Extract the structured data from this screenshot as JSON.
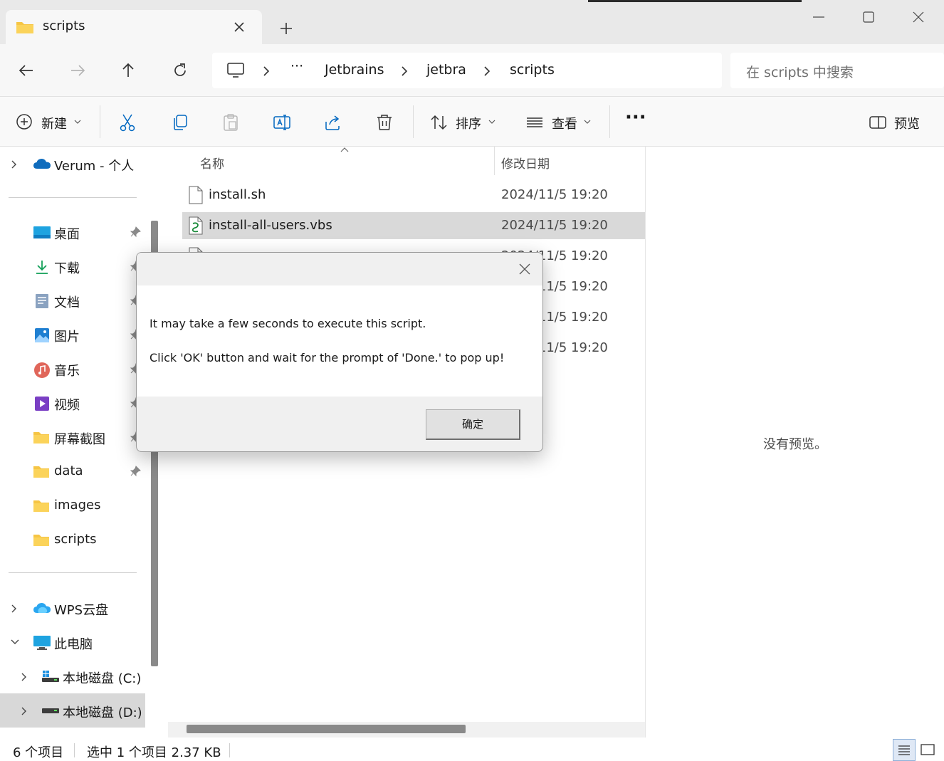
{
  "window": {
    "tab_title": "scripts"
  },
  "address": {
    "overflow": "···",
    "crumbs": [
      "Jetbrains",
      "jetbra",
      "scripts"
    ]
  },
  "search": {
    "placeholder": "在 scripts 中搜索"
  },
  "toolbar": {
    "new_label": "新建",
    "sort_label": "排序",
    "view_label": "查看",
    "more_label": "···",
    "preview_label": "预览"
  },
  "sidebar": {
    "cloud_item": "Verum - 个人",
    "quick_access": [
      {
        "label": "桌面",
        "icon": "desktop-icon"
      },
      {
        "label": "下载",
        "icon": "download-icon"
      },
      {
        "label": "文档",
        "icon": "documents-icon"
      },
      {
        "label": "图片",
        "icon": "pictures-icon"
      },
      {
        "label": "音乐",
        "icon": "music-icon"
      },
      {
        "label": "视频",
        "icon": "videos-icon"
      },
      {
        "label": "屏幕截图",
        "icon": "folder-icon"
      },
      {
        "label": "data",
        "icon": "folder-icon"
      },
      {
        "label": "images",
        "icon": "folder-icon"
      },
      {
        "label": "scripts",
        "icon": "folder-icon"
      }
    ],
    "wps": "WPS云盘",
    "this_pc": "此电脑",
    "drive_c": "本地磁盘 (C:)",
    "drive_d": "本地磁盘 (D:)"
  },
  "filelist": {
    "col_name": "名称",
    "col_date": "修改日期",
    "rows": [
      {
        "name": "install.sh",
        "date": "2024/11/5 19:20"
      },
      {
        "name": "install-all-users.vbs",
        "date": "2024/11/5 19:20"
      },
      {
        "name": "",
        "date": "2024/11/5 19:20"
      },
      {
        "name": "",
        "date": "2024/11/5 19:20"
      },
      {
        "name": "",
        "date": "2024/11/5 19:20"
      },
      {
        "name": "",
        "date": "2024/11/5 19:20"
      }
    ]
  },
  "preview": {
    "empty_text": "没有预览。"
  },
  "status": {
    "count": "6 个项目",
    "selection": "选中 1 个项目  2.37 KB"
  },
  "dialog": {
    "line1": "It may take a few seconds to execute this script.",
    "line2": "Click 'OK' button and wait for the prompt of 'Done.' to pop up!",
    "ok_label": "确定"
  },
  "colors": {
    "accent": "#0067c0",
    "folder": "#f6c544",
    "selection": "#d9d9d9"
  }
}
